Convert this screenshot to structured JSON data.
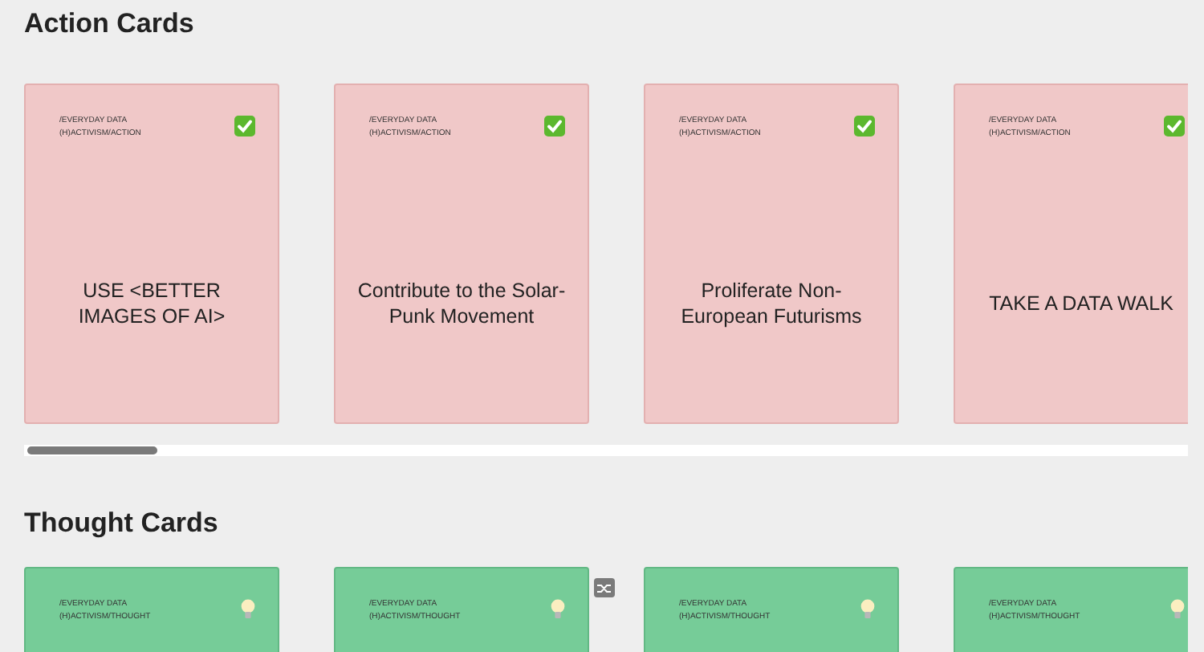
{
  "sections": [
    {
      "title": "Action Cards",
      "kind": "action",
      "cards": [
        {
          "category_lines": [
            "/EVERYDAY DATA",
            "(H)ACTIVISM/ACTION"
          ],
          "title": "USE <BETTER IMAGES OF AI>"
        },
        {
          "category_lines": [
            "/EVERYDAY DATA",
            "(H)ACTIVISM/ACTION"
          ],
          "title": "Contribute to the Solar-Punk Movement"
        },
        {
          "category_lines": [
            "/EVERYDAY DATA",
            "(H)ACTIVISM/ACTION"
          ],
          "title": "Proliferate Non-European Futurisms"
        },
        {
          "category_lines": [
            "/EVERYDAY DATA",
            "(H)ACTIVISM/ACTION"
          ],
          "title": "TAKE A DATA WALK"
        }
      ]
    },
    {
      "title": "Thought Cards",
      "kind": "thought",
      "cards": [
        {
          "category_lines": [
            "/EVERYDAY DATA",
            "(H)ACTIVISM/THOUGHT"
          ]
        },
        {
          "category_lines": [
            "/EVERYDAY DATA",
            "(H)ACTIVISM/THOUGHT"
          ]
        },
        {
          "category_lines": [
            "/EVERYDAY DATA",
            "(H)ACTIVISM/THOUGHT"
          ]
        },
        {
          "category_lines": [
            "/EVERYDAY DATA",
            "(H)ACTIVISM/THOUGHT"
          ]
        }
      ]
    }
  ]
}
